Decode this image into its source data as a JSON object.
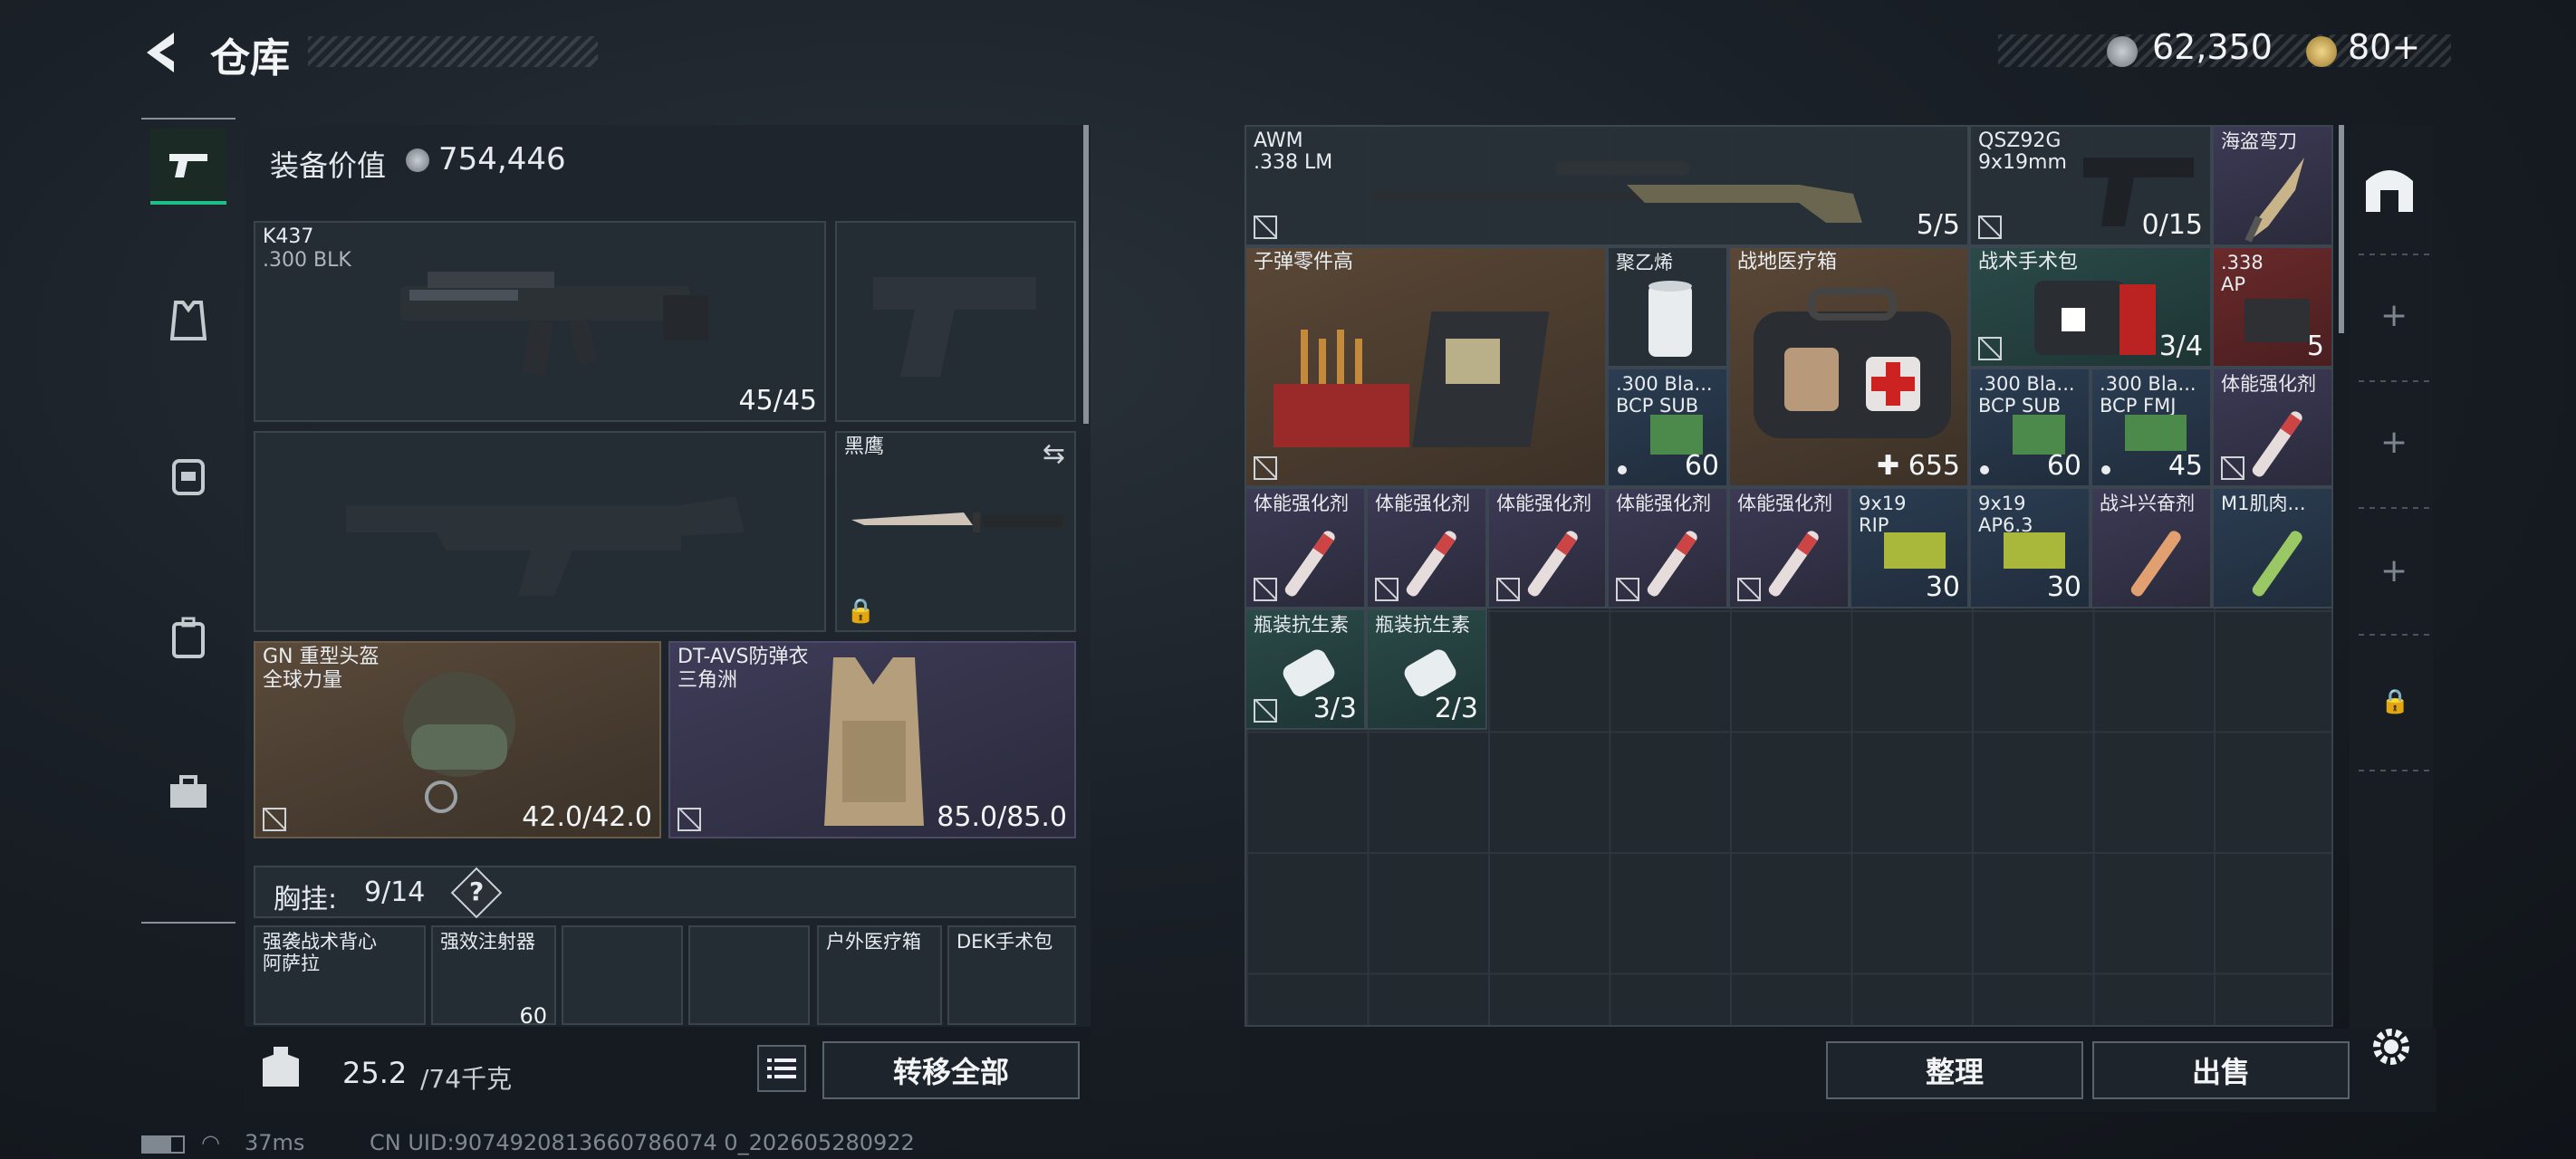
{
  "header": {
    "title": "仓库",
    "silver": "62,350",
    "gold": "80+"
  },
  "left": {
    "equip_value_label": "装备价值",
    "equip_value": "754,446",
    "primary": {
      "name": "K437",
      "ammo": ".300 BLK",
      "count": "45/45"
    },
    "knife": {
      "name": "黑鹰"
    },
    "helmet": {
      "name": "GN 重型头盔",
      "sub": "全球力量",
      "durability": "42.0/42.0"
    },
    "armor": {
      "name": "DT-AVS防弹衣",
      "sub": "三角洲",
      "durability": "85.0/85.0"
    },
    "chest_label": "胸挂:",
    "chest_count": "9/14",
    "help": "?",
    "chest_items": [
      {
        "name": "强袭战术背心",
        "sub": "阿萨拉"
      },
      {
        "name": "强效注射器",
        "sub": ""
      },
      {
        "name": "",
        "sub": ""
      },
      {
        "name": "",
        "sub": ""
      },
      {
        "name": "户外医疗箱",
        "sub": ""
      },
      {
        "name": "DEK手术包",
        "sub": ""
      }
    ],
    "chest_partial": "60",
    "weight": "25.2",
    "weight_max": "/74千克",
    "transfer_all": "转移全部"
  },
  "stash": {
    "awm": {
      "name": "AWM",
      "sub": ".338 LM",
      "count": "5/5"
    },
    "qsz": {
      "name": "QSZ92G",
      "sub": "9x19mm",
      "count": "0/15"
    },
    "pirate_knife": {
      "name": "海盗弯刀"
    },
    "ammo_parts": {
      "name": "子弹零件高"
    },
    "polyethylene": {
      "name": "聚乙烯"
    },
    "field_med": {
      "name": "战地医疗箱",
      "count": "655"
    },
    "surgical_kit": {
      "name": "战术手术包",
      "count": "3/4"
    },
    "ap338": {
      "name": ".338",
      "sub": "AP",
      "count": "5"
    },
    "row3": [
      {
        "name": ".300 Bla...",
        "sub": "BCP SUB",
        "count": "60"
      },
      {
        "name": ".300 Bla...",
        "sub": "BCP SUB",
        "count": "60"
      },
      {
        "name": ".300 Bla...",
        "sub": "BCP FMJ",
        "count": "45"
      },
      {
        "name": "体能强化剂",
        "sub": "",
        "count": ""
      }
    ],
    "row4": [
      {
        "name": "体能强化剂",
        "sub": "",
        "count": ""
      },
      {
        "name": "体能强化剂",
        "sub": "",
        "count": ""
      },
      {
        "name": "体能强化剂",
        "sub": "",
        "count": ""
      },
      {
        "name": "体能强化剂",
        "sub": "",
        "count": ""
      },
      {
        "name": "体能强化剂",
        "sub": "",
        "count": ""
      },
      {
        "name": "9x19",
        "sub": "RIP",
        "count": "30"
      },
      {
        "name": "9x19",
        "sub": "AP6.3",
        "count": "30"
      },
      {
        "name": "战斗兴奋剂",
        "sub": "",
        "count": ""
      },
      {
        "name": "M1肌肉...",
        "sub": "",
        "count": ""
      }
    ],
    "row5": [
      {
        "name": "瓶装抗生素",
        "count": "3/3"
      },
      {
        "name": "瓶装抗生素",
        "count": "2/3"
      }
    ],
    "sort": "整理",
    "sell": "出售"
  },
  "status": {
    "ping": "37ms",
    "uid": "CN UID:9074920813660786074 0_202605280922"
  }
}
